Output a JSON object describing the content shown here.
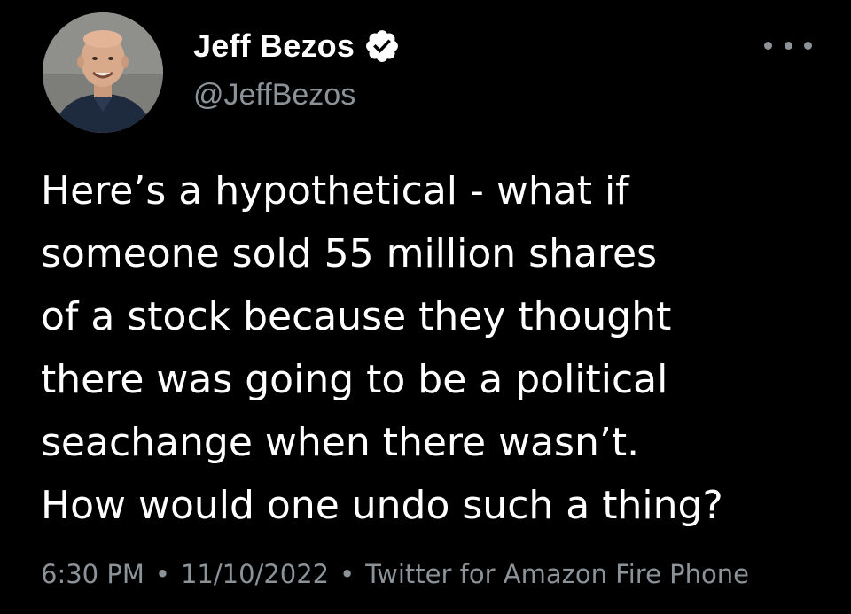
{
  "author": {
    "name": "Jeff Bezos",
    "handle": "@JeffBezos",
    "verified": true,
    "avatar_icon": "profile-photo"
  },
  "menu": {
    "more_icon": "more-horizontal-icon"
  },
  "tweet": {
    "lines": [
      "Here’s a hypothetical - what if",
      "someone sold 55 million shares",
      "of a stock because they thought",
      "there was going to be a political",
      "seachange when there wasn’t.",
      "How would one undo such a thing?"
    ]
  },
  "meta": {
    "time": "6:30 PM",
    "separator": "•",
    "date": "11/10/2022",
    "source": "Twitter for Amazon Fire Phone"
  },
  "colors": {
    "background": "#000000",
    "text": "#ffffff",
    "secondary": "#8b9298",
    "verified_badge": "#ffffff"
  }
}
